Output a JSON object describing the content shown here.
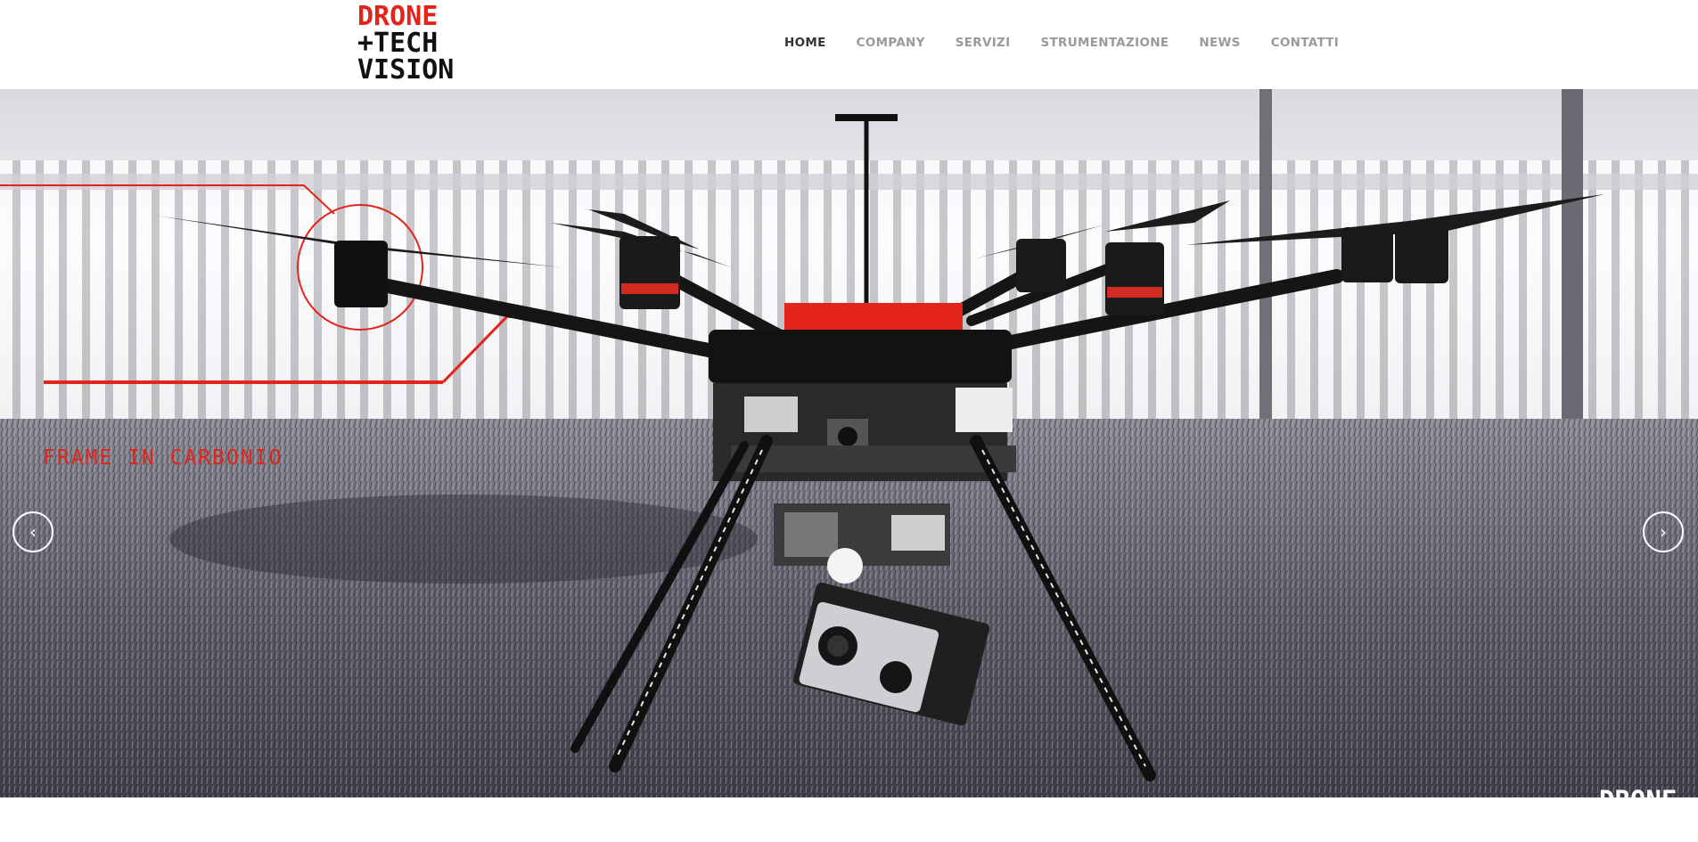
{
  "brand": {
    "logo_line1": "DRONE",
    "logo_line2": "+TECH",
    "logo_line3": "VISION",
    "accent_color": "#e3241b"
  },
  "nav": {
    "items": [
      {
        "label": "HOME",
        "active": true
      },
      {
        "label": "COMPANY",
        "active": false
      },
      {
        "label": "SERVIZI",
        "active": false
      },
      {
        "label": "STRUMENTAZIONE",
        "active": false
      },
      {
        "label": "NEWS",
        "active": false
      },
      {
        "label": "CONTATTI",
        "active": false
      }
    ]
  },
  "hero": {
    "callout": "FRAME IN CARBONIO",
    "prev_icon": "chevron-left-icon",
    "next_icon": "chevron-right-icon",
    "prev_glyph": "‹",
    "next_glyph": "›"
  }
}
